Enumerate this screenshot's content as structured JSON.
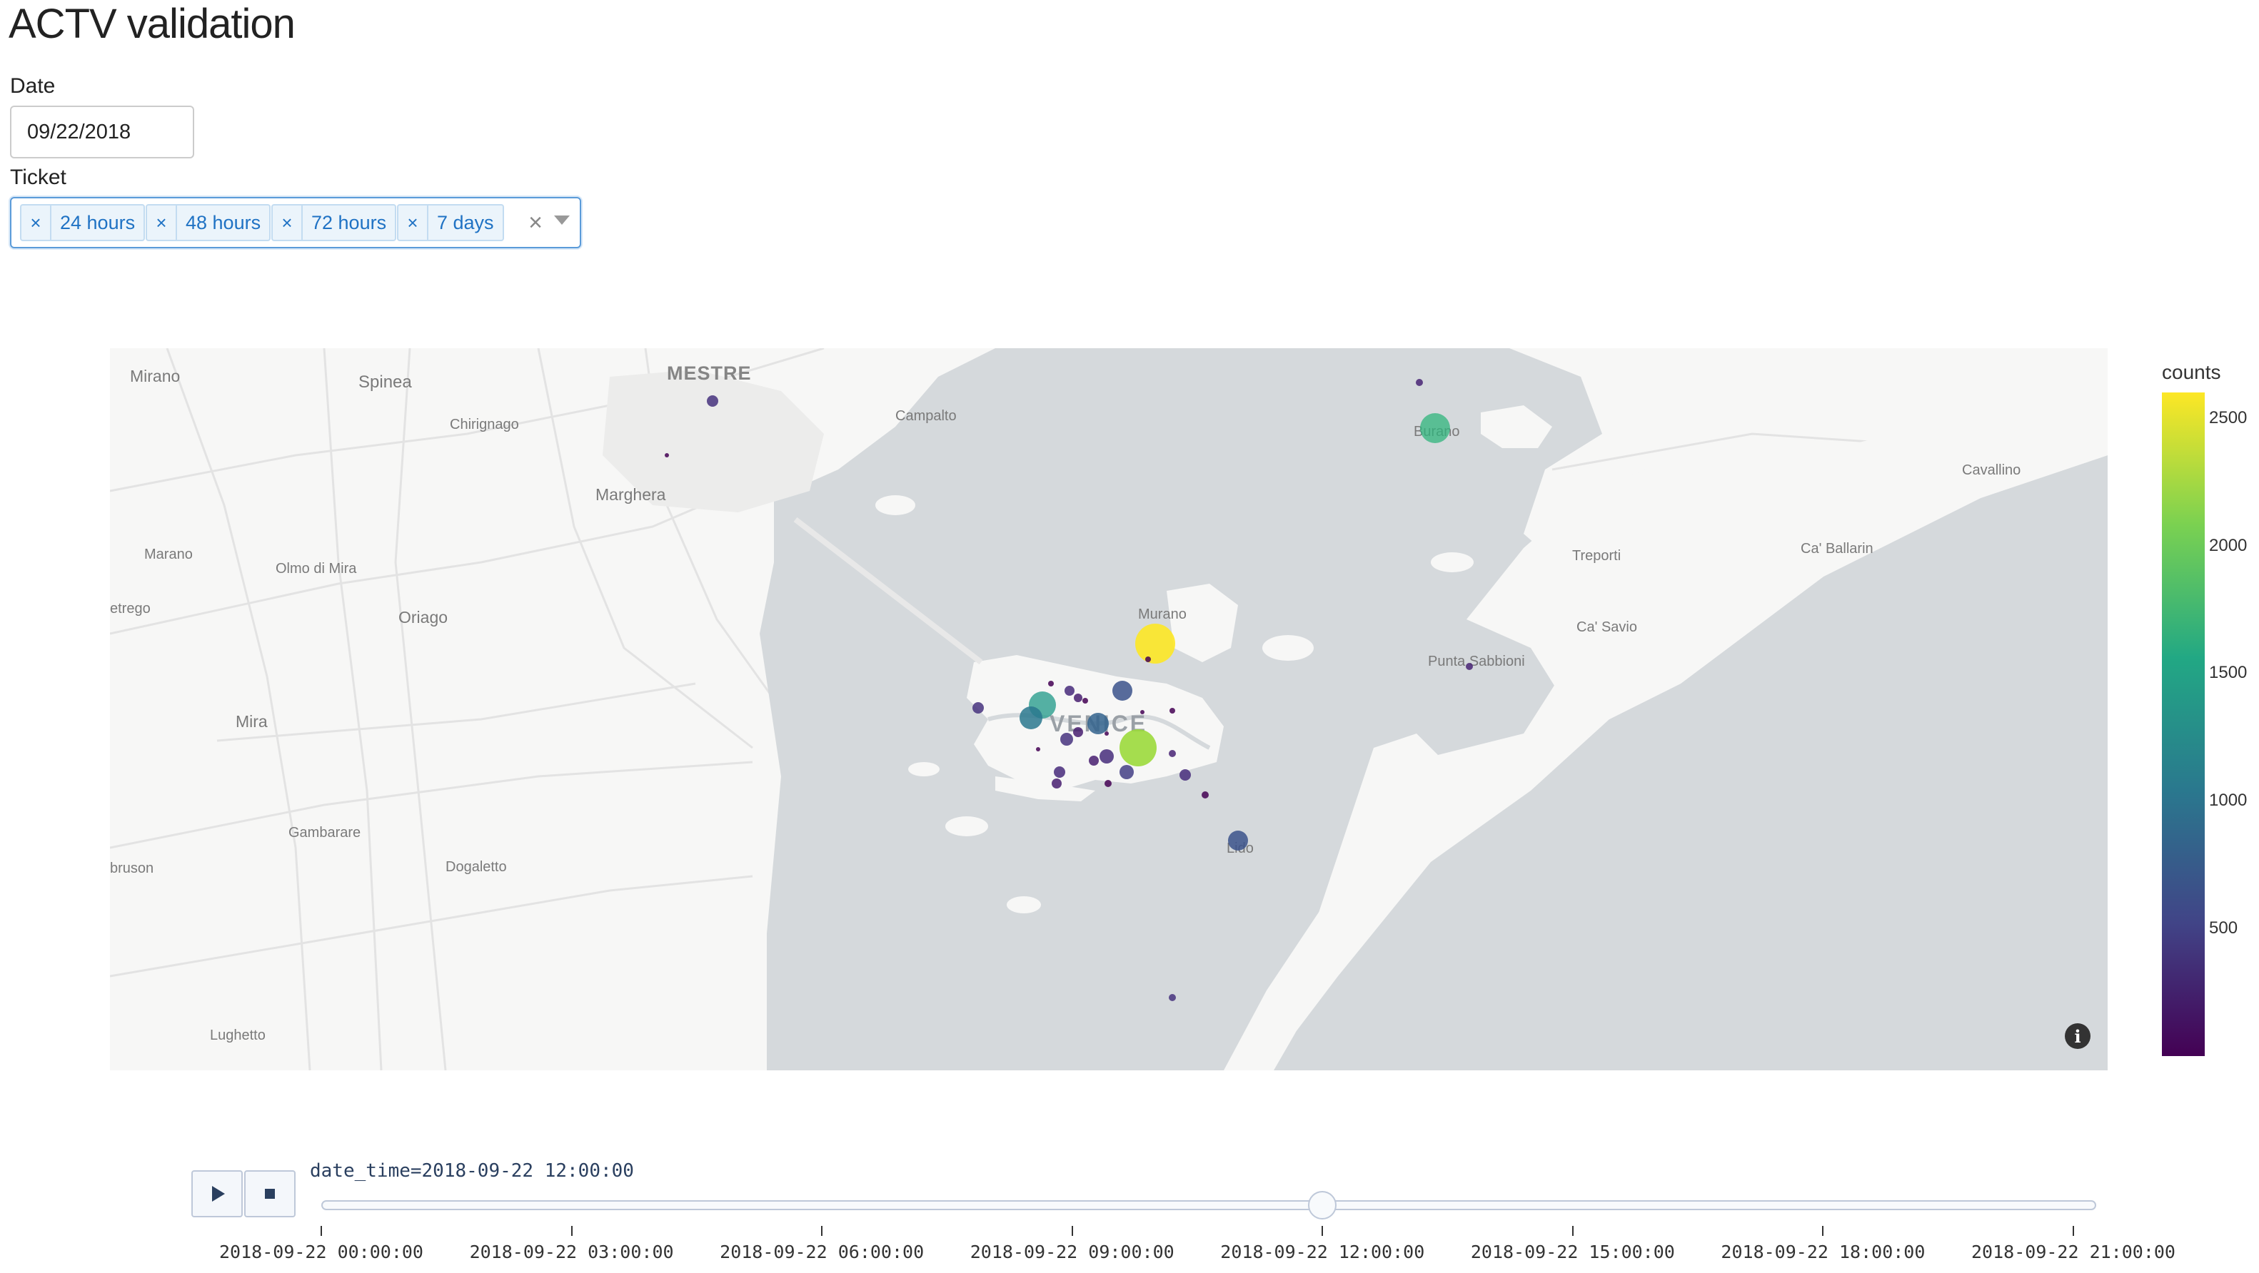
{
  "page": {
    "title": "ACTV validation"
  },
  "filters": {
    "date_label": "Date",
    "date_value": "09/22/2018",
    "ticket_label": "Ticket",
    "ticket_chips": [
      "24 hours",
      "48 hours",
      "72 hours",
      "7 days"
    ],
    "chip_remove_glyph": "×",
    "clear_glyph": "×"
  },
  "map": {
    "places": [
      "Mirano",
      "Spinea",
      "MESTRE",
      "Chirignago",
      "Campalto",
      "Marghera",
      "Marano",
      "Olmo di Mira",
      "Oriago",
      "etrego",
      "Mira",
      "Gambarare",
      "bruson",
      "Dogaletto",
      "Lughetto",
      "Murano",
      "VENICE",
      "Lido",
      "Burano",
      "Treporti",
      "Ca' Ballarin",
      "Cavallino",
      "Ca' Savio",
      "Punta Sabbioni"
    ],
    "info_glyph": "i",
    "colors": {
      "land": "#f7f7f6",
      "water": "#d5d9dc",
      "roads": "#e4e4e4",
      "city": "#ececeb"
    }
  },
  "colorbar": {
    "title": "counts",
    "ticks": [
      "2500",
      "2000",
      "1500",
      "1000",
      "500"
    ],
    "tick_values": [
      2500,
      2000,
      1500,
      1000,
      500
    ],
    "range": [
      0,
      2600
    ],
    "colors": [
      "#fde725",
      "#7ad151",
      "#22a884",
      "#2a788e",
      "#414487",
      "#440154"
    ]
  },
  "animation": {
    "current_label": "date_time=2018-09-22 12:00:00",
    "current_index": 4,
    "steps": [
      "2018-09-22 00:00:00",
      "2018-09-22 03:00:00",
      "2018-09-22 06:00:00",
      "2018-09-22 09:00:00",
      "2018-09-22 12:00:00",
      "2018-09-22 15:00:00",
      "2018-09-22 18:00:00",
      "2018-09-22 21:00:00"
    ],
    "play_icon": "play-icon",
    "stop_icon": "stop-icon"
  }
}
